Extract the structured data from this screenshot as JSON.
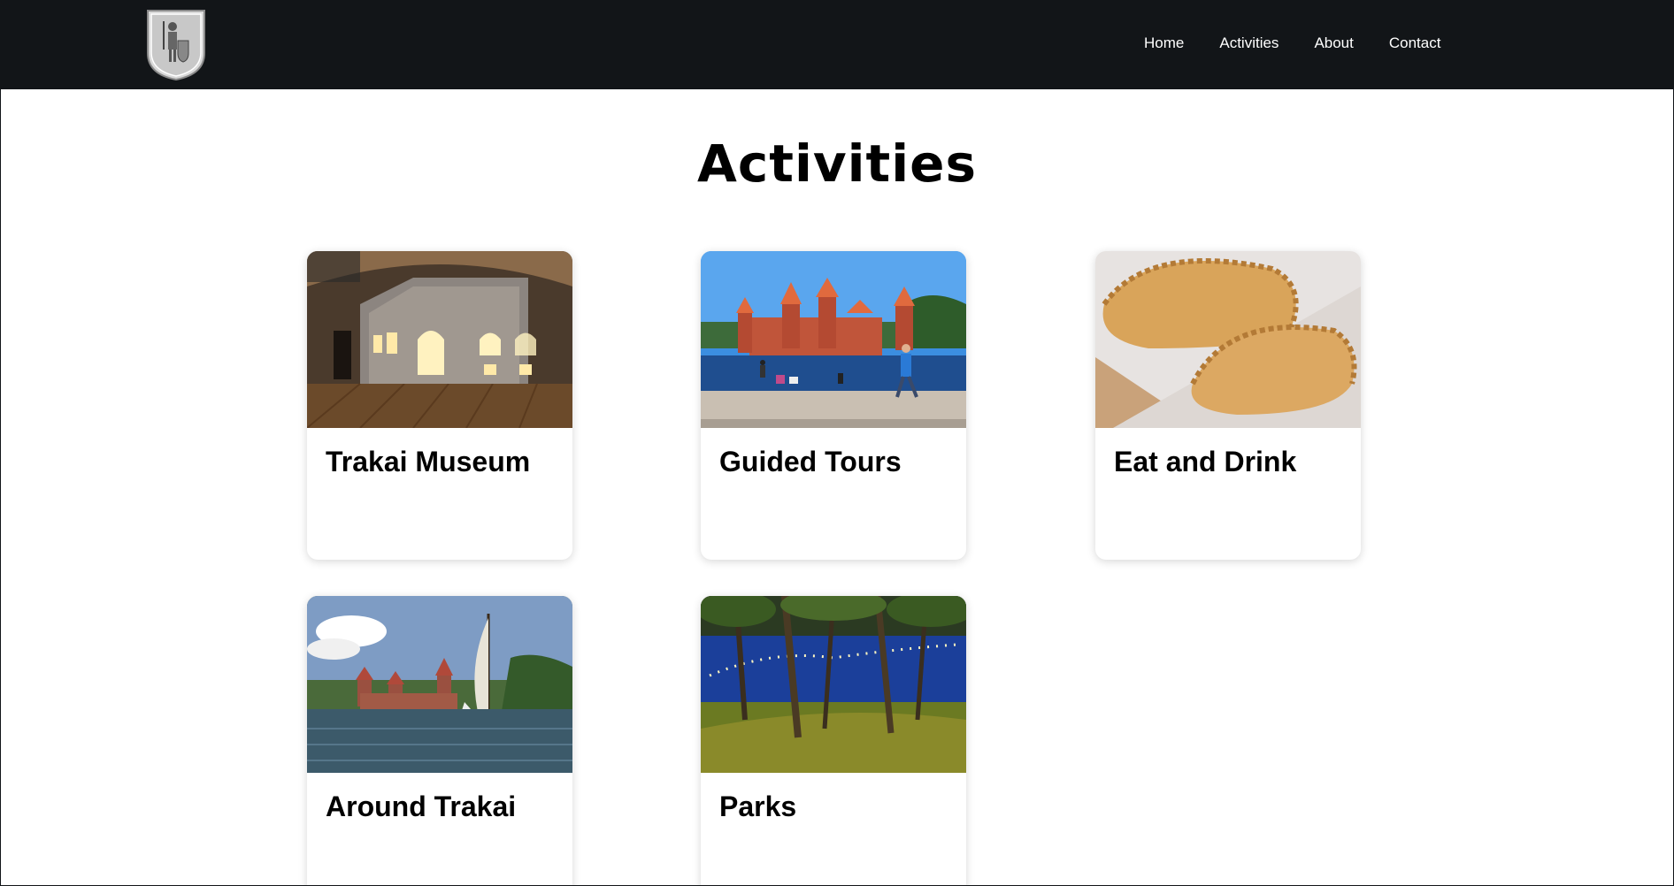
{
  "nav": {
    "logo_alt": "Trakai coat of arms",
    "links": [
      {
        "label": "Home"
      },
      {
        "label": "Activities"
      },
      {
        "label": "About"
      },
      {
        "label": "Contact"
      }
    ]
  },
  "main": {
    "title": "Activities",
    "cards": [
      {
        "title": "Trakai Museum",
        "image": "museum-interior"
      },
      {
        "title": "Guided Tours",
        "image": "island-castle"
      },
      {
        "title": "Eat and Drink",
        "image": "kibinai-pastries"
      },
      {
        "title": "Around Trakai",
        "image": "sailing-ship-castle"
      },
      {
        "title": "Parks",
        "image": "park-lights"
      }
    ]
  },
  "colors": {
    "nav_background": "#121518",
    "nav_text": "#ffffff",
    "title_text": "#000000",
    "card_background": "#ffffff"
  }
}
